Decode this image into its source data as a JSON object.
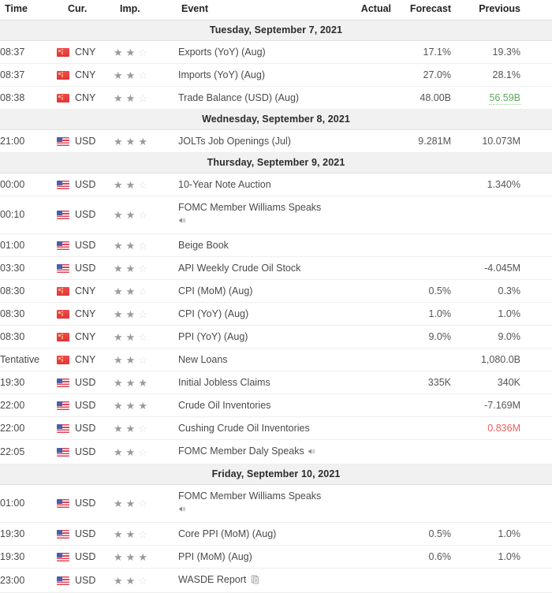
{
  "header": {
    "time": "Time",
    "currency": "Cur.",
    "importance": "Imp.",
    "event": "Event",
    "actual": "Actual",
    "forecast": "Forecast",
    "previous": "Previous"
  },
  "colors": {
    "positive": "#5bab5b",
    "negative": "#e8605f",
    "neutral": "#555555",
    "date_band": "#f1f1f1",
    "star_full": "#9a9a9a",
    "star_empty": "#dedede"
  },
  "icons": {
    "speaker": "speaker-icon",
    "report": "report-icon",
    "star_full": "★",
    "star_empty": "☆"
  },
  "rows": [
    {
      "kind": "date",
      "label": "Tuesday, September 7, 2021"
    },
    {
      "kind": "event",
      "time": "08:37",
      "currency": "CNY",
      "flag": "cny",
      "stars": 2,
      "event": "Exports (YoY) (Aug)",
      "actual": "",
      "forecast": "17.1%",
      "previous": "19.3%",
      "previous_style": "plain",
      "icon": "",
      "two_line": false
    },
    {
      "kind": "event",
      "time": "08:37",
      "currency": "CNY",
      "flag": "cny",
      "stars": 2,
      "event": "Imports (YoY) (Aug)",
      "actual": "",
      "forecast": "27.0%",
      "previous": "28.1%",
      "previous_style": "plain",
      "icon": "",
      "two_line": false
    },
    {
      "kind": "event",
      "time": "08:38",
      "currency": "CNY",
      "flag": "cny",
      "stars": 2,
      "event": "Trade Balance (USD) (Aug)",
      "actual": "",
      "forecast": "48.00B",
      "previous": "56.59B",
      "previous_style": "green",
      "icon": "",
      "two_line": false
    },
    {
      "kind": "date",
      "label": "Wednesday, September 8, 2021"
    },
    {
      "kind": "event",
      "time": "21:00",
      "currency": "USD",
      "flag": "usd",
      "stars": 3,
      "event": "JOLTs Job Openings (Jul)",
      "actual": "",
      "forecast": "9.281M",
      "previous": "10.073M",
      "previous_style": "plain",
      "icon": "",
      "two_line": false
    },
    {
      "kind": "date",
      "label": "Thursday, September 9, 2021"
    },
    {
      "kind": "event",
      "time": "00:00",
      "currency": "USD",
      "flag": "usd",
      "stars": 2,
      "event": "10-Year Note Auction",
      "actual": "",
      "forecast": "",
      "previous": "1.340%",
      "previous_style": "plain",
      "icon": "",
      "two_line": false
    },
    {
      "kind": "event",
      "time": "00:10",
      "currency": "USD",
      "flag": "usd",
      "stars": 2,
      "event": "FOMC Member Williams Speaks",
      "actual": "",
      "forecast": "",
      "previous": "",
      "previous_style": "plain",
      "icon": "speaker-below",
      "two_line": true
    },
    {
      "kind": "event",
      "time": "01:00",
      "currency": "USD",
      "flag": "usd",
      "stars": 2,
      "event": "Beige Book",
      "actual": "",
      "forecast": "",
      "previous": "",
      "previous_style": "plain",
      "icon": "",
      "two_line": false
    },
    {
      "kind": "event",
      "time": "03:30",
      "currency": "USD",
      "flag": "usd",
      "stars": 2,
      "event": "API Weekly Crude Oil Stock",
      "actual": "",
      "forecast": "",
      "previous": "-4.045M",
      "previous_style": "plain",
      "icon": "",
      "two_line": false
    },
    {
      "kind": "event",
      "time": "08:30",
      "currency": "CNY",
      "flag": "cny",
      "stars": 2,
      "event": "CPI (MoM) (Aug)",
      "actual": "",
      "forecast": "0.5%",
      "previous": "0.3%",
      "previous_style": "plain",
      "icon": "",
      "two_line": false
    },
    {
      "kind": "event",
      "time": "08:30",
      "currency": "CNY",
      "flag": "cny",
      "stars": 2,
      "event": "CPI (YoY) (Aug)",
      "actual": "",
      "forecast": "1.0%",
      "previous": "1.0%",
      "previous_style": "plain",
      "icon": "",
      "two_line": false
    },
    {
      "kind": "event",
      "time": "08:30",
      "currency": "CNY",
      "flag": "cny",
      "stars": 2,
      "event": "PPI (YoY) (Aug)",
      "actual": "",
      "forecast": "9.0%",
      "previous": "9.0%",
      "previous_style": "plain",
      "icon": "",
      "two_line": false
    },
    {
      "kind": "event",
      "time": "Tentative",
      "currency": "CNY",
      "flag": "cny",
      "stars": 2,
      "event": "New Loans",
      "actual": "",
      "forecast": "",
      "previous": "1,080.0B",
      "previous_style": "plain",
      "icon": "",
      "two_line": false
    },
    {
      "kind": "event",
      "time": "19:30",
      "currency": "USD",
      "flag": "usd",
      "stars": 3,
      "event": "Initial Jobless Claims",
      "actual": "",
      "forecast": "335K",
      "previous": "340K",
      "previous_style": "plain",
      "icon": "",
      "two_line": false
    },
    {
      "kind": "event",
      "time": "22:00",
      "currency": "USD",
      "flag": "usd",
      "stars": 3,
      "event": "Crude Oil Inventories",
      "actual": "",
      "forecast": "",
      "previous": "-7.169M",
      "previous_style": "plain",
      "icon": "",
      "two_line": false
    },
    {
      "kind": "event",
      "time": "22:00",
      "currency": "USD",
      "flag": "usd",
      "stars": 2,
      "event": "Cushing Crude Oil Inventories",
      "actual": "",
      "forecast": "",
      "previous": "0.836M",
      "previous_style": "red",
      "icon": "",
      "two_line": false
    },
    {
      "kind": "event",
      "time": "22:05",
      "currency": "USD",
      "flag": "usd",
      "stars": 2,
      "event": "FOMC Member Daly Speaks",
      "actual": "",
      "forecast": "",
      "previous": "",
      "previous_style": "plain",
      "icon": "speaker-inline",
      "two_line": false
    },
    {
      "kind": "date",
      "label": "Friday, September 10, 2021"
    },
    {
      "kind": "event",
      "time": "01:00",
      "currency": "USD",
      "flag": "usd",
      "stars": 2,
      "event": "FOMC Member Williams Speaks",
      "actual": "",
      "forecast": "",
      "previous": "",
      "previous_style": "plain",
      "icon": "speaker-below",
      "two_line": true
    },
    {
      "kind": "event",
      "time": "19:30",
      "currency": "USD",
      "flag": "usd",
      "stars": 2,
      "event": "Core PPI (MoM) (Aug)",
      "actual": "",
      "forecast": "0.5%",
      "previous": "1.0%",
      "previous_style": "plain",
      "icon": "",
      "two_line": false
    },
    {
      "kind": "event",
      "time": "19:30",
      "currency": "USD",
      "flag": "usd",
      "stars": 3,
      "event": "PPI (MoM) (Aug)",
      "actual": "",
      "forecast": "0.6%",
      "previous": "1.0%",
      "previous_style": "plain",
      "icon": "",
      "two_line": false
    },
    {
      "kind": "event",
      "time": "23:00",
      "currency": "USD",
      "flag": "usd",
      "stars": 2,
      "event": "WASDE Report",
      "actual": "",
      "forecast": "",
      "previous": "",
      "previous_style": "plain",
      "icon": "report-inline",
      "two_line": false
    }
  ]
}
